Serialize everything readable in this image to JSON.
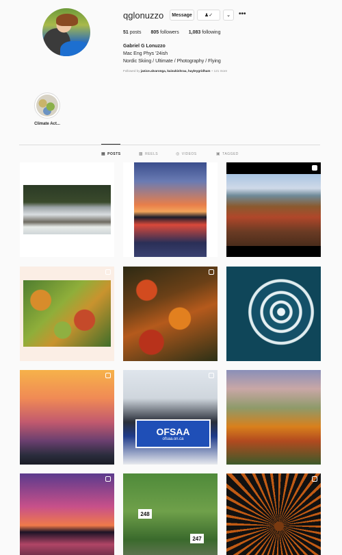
{
  "profile": {
    "username": "qglonuzzo",
    "message_label": "Message",
    "follow_icon": "person-check-icon",
    "more_icon": "more-horizontal-icon",
    "stats": {
      "posts_count": "51",
      "posts_label": "posts",
      "followers_count": "805",
      "followers_label": "followers",
      "following_count": "1,083",
      "following_label": "following"
    },
    "full_name": "Gabriel G Lonuzzo",
    "bio_line1": "Mac Eng Phys '24ish",
    "bio_line2": "Nordic Skiing / Ultimate / Photography / Flying",
    "followed_prefix": "Followed by",
    "followed_names": "janice.alvaronga, kaisukishrau, hayleygridham",
    "followed_more": "+ 121 more"
  },
  "highlights": [
    {
      "label": "Climate Act..."
    }
  ],
  "tabs": [
    {
      "label": "POSTS",
      "icon": "grid-icon",
      "active": true
    },
    {
      "label": "REELS",
      "icon": "reels-icon",
      "active": false
    },
    {
      "label": "VIDEOS",
      "icon": "video-icon",
      "active": false
    },
    {
      "label": "TAGGED",
      "icon": "tag-icon",
      "active": false
    }
  ],
  "posts": [
    {
      "desc": "snowy river in forest",
      "multi": false
    },
    {
      "desc": "sunset over lake",
      "multi": false
    },
    {
      "desc": "aerial autumn valley",
      "multi": false,
      "reel": true
    },
    {
      "desc": "aerial autumn forest with road",
      "multi": true
    },
    {
      "desc": "aerial autumn forest",
      "multi": true
    },
    {
      "desc": "jet ski spiral wake",
      "multi": false
    },
    {
      "desc": "orange sunset clouds",
      "multi": true
    },
    {
      "desc": "ofsaa team photo",
      "multi": true,
      "banner_text": "OFSAA",
      "banner_sub": "ofsaa.on.ca"
    },
    {
      "desc": "aerial autumn fields",
      "multi": false
    },
    {
      "desc": "purple sunset lake",
      "multi": true
    },
    {
      "desc": "runners with bibs",
      "multi": false,
      "bib1": "248",
      "bib2": "247"
    },
    {
      "desc": "fireworks burst",
      "multi": true
    }
  ]
}
